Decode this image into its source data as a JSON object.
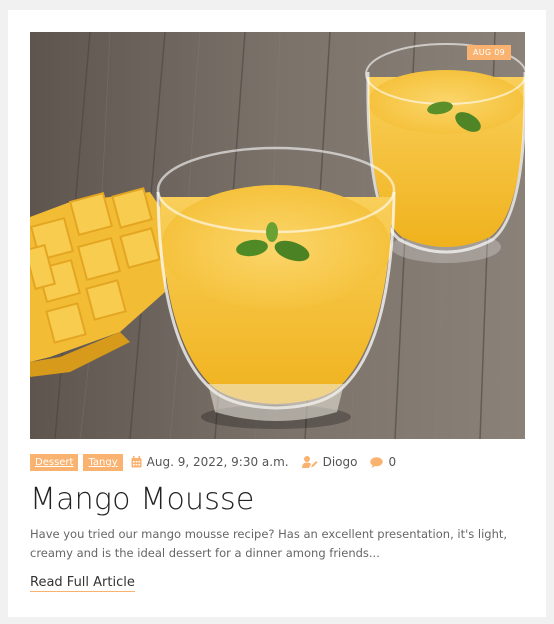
{
  "article": {
    "date_badge": "AUG 09",
    "tags": [
      "Dessert",
      "Tangy"
    ],
    "datetime": "Aug. 9, 2022, 9:30 a.m.",
    "author": "Diogo",
    "comments": "0",
    "title": "Mango Mousse",
    "excerpt": "Have you tried our mango mousse recipe? Has an excellent presentation, it's light, creamy and is the ideal dessert for a dinner among friends...",
    "read_more": "Read Full Article"
  },
  "icons": {
    "date": "calendar-icon",
    "author": "user-edit-icon",
    "comments": "comment-icon"
  },
  "colors": {
    "accent": "#f9b26f",
    "mousse": "#f6c033",
    "wood": "#6f665e"
  }
}
